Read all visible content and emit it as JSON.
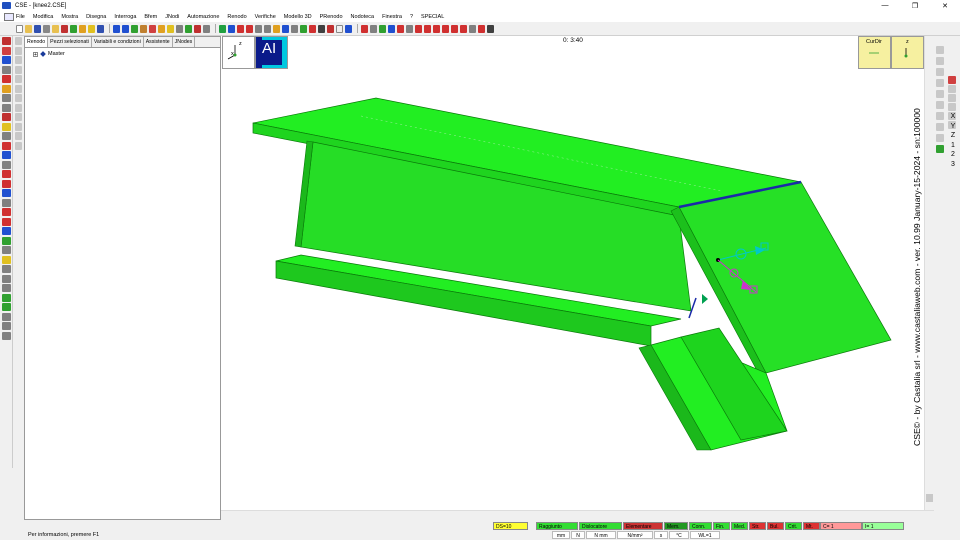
{
  "window": {
    "title": "CSE - [knee2.CSE]",
    "minimize": "—",
    "maximize": "❐",
    "close": "✕"
  },
  "menu": [
    "File",
    "Modifica",
    "Mostra",
    "Disegna",
    "Interroga",
    "Bfem",
    "JNodi",
    "Automazione",
    "Renodo",
    "Verifiche",
    "Modello 3D",
    "PRenodo",
    "Nodoteca",
    "Finestra",
    "?",
    "SPECIAL"
  ],
  "panel": {
    "tabs": [
      "Renodo",
      "Pezzi selezionati",
      "Variabili e condizioni",
      "Assistente",
      "JNodes"
    ],
    "tree": {
      "expander": "+",
      "root": "Master"
    }
  },
  "viewport": {
    "timer": "0: 3:40",
    "view_cube": {
      "mode_label": "AI",
      "axis_z": "z",
      "axis_x": "x"
    },
    "curdir": {
      "label": "CurDir",
      "axis_z": "z"
    },
    "watermark": "CSE© - by Castalia srl - www.castaliaweb.com - ver. 10.99 January-15-2024 - sn:100000",
    "model_color": "#22dd22",
    "edge_highlight_color": "#1a2aa8"
  },
  "axis_buttons": [
    "X",
    "Y",
    "Z",
    "1",
    "2",
    "3"
  ],
  "status": {
    "info": "Per informazioni, premere F1",
    "boxes": [
      {
        "label": "DS=10",
        "color": "#ffff33"
      },
      {
        "label": "Raggiunto",
        "color": "#33dd33"
      },
      {
        "label": "Dislocatore",
        "color": "#33dd33"
      },
      {
        "label": "Elementare",
        "color": "#cc3333"
      },
      {
        "label": "Mem.",
        "color": "#229922"
      },
      {
        "label": "Conn.",
        "color": "#33dd33"
      },
      {
        "label": "Fin.",
        "color": "#33dd33"
      },
      {
        "label": "Med.",
        "color": "#33dd33"
      },
      {
        "label": "Str.",
        "color": "#dd3333"
      },
      {
        "label": "Bul.",
        "color": "#dd3333"
      },
      {
        "label": "Crit.",
        "color": "#33dd33"
      },
      {
        "label": "Mt.",
        "color": "#dd3333"
      },
      {
        "label": "C= 1",
        "color": "#ff9999"
      },
      {
        "label": "I= 1",
        "color": "#99ff99"
      }
    ],
    "units": [
      "mm",
      "N",
      "N mm",
      "N/mm²",
      "s",
      "°C",
      "WL=1"
    ]
  }
}
